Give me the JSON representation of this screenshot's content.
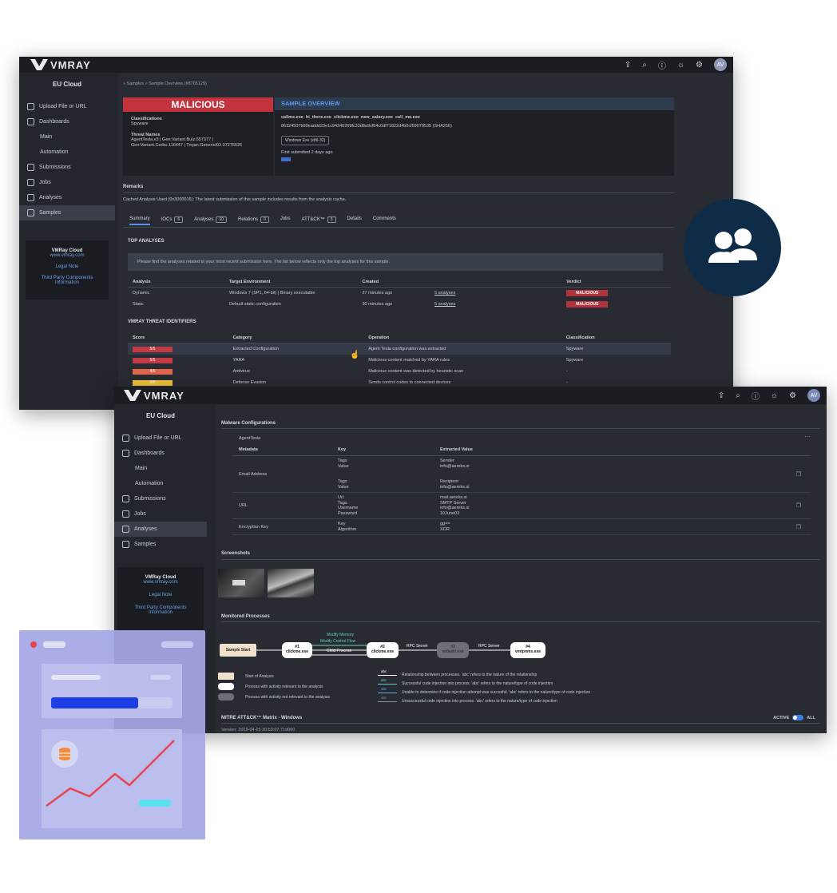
{
  "window1": {
    "logo": "VMRAY",
    "avatar": "AV",
    "region": "EU Cloud",
    "breadcrumb": "» Samples » Sample Overview (#8705129)",
    "nav": [
      {
        "label": "Upload File or URL",
        "icon": "upload-icon"
      },
      {
        "label": "Dashboards",
        "icon": "dashboard-icon"
      },
      {
        "label": "Main",
        "sub": true
      },
      {
        "label": "Automation",
        "sub": true
      },
      {
        "label": "Submissions",
        "icon": "database-icon"
      },
      {
        "label": "Jobs",
        "icon": "jobs-icon"
      },
      {
        "label": "Analyses",
        "icon": "analyses-icon"
      },
      {
        "label": "Samples",
        "icon": "file-icon",
        "active": true
      }
    ],
    "cloud": {
      "title": "VMRay Cloud",
      "url": "www.vmray.com",
      "legal": "Legal Note",
      "third_party": "Third Party Components Information"
    },
    "verdict": "MALICIOUS",
    "classifications_label": "Classifications",
    "classifications_value": "Spyware",
    "threat_names_label": "Threat Names",
    "threat_names_value": "AgentTesla.v3 | Gen:Variant.Bulz.557377 | Gen:Variant.Cerbu.116447 | Trojan.GenericKD.37276526",
    "overview_title": "SAMPLE OVERVIEW",
    "filenames": "callme.exe  hi_there.exe  clickme.exe  new_salary.exe  call_me.exe",
    "hash": "86324507b99eaddd23e1c94340269fc33d8a9cf64c6df71822d4b0cf59078535",
    "hash_type": "(SHA256)",
    "file_type": "Windows Exe (x86-32)",
    "first_submitted": "First submitted 2 days ago",
    "remarks_title": "Remarks",
    "remarks_text": "Cached Analysis Used (0x3000016): The latest submission of this sample includes results from the analysis cache.",
    "tabs": [
      {
        "label": "Summary",
        "active": true
      },
      {
        "label": "IOCs",
        "count": "6"
      },
      {
        "label": "Analyses",
        "count": "10"
      },
      {
        "label": "Relations",
        "count": "0"
      },
      {
        "label": "Jobs"
      },
      {
        "label": "ATT&CK™",
        "count": "3"
      },
      {
        "label": "Details"
      },
      {
        "label": "Comments"
      }
    ],
    "top_analyses_title": "TOP ANALYSES",
    "info_text": "Please find the analyses related to your most recent submission here. The list below reflects only the top analyses for this sample.",
    "analyses_headers": [
      "Analysis",
      "Target Environment",
      "Created",
      "",
      "Verdict"
    ],
    "analyses_rows": [
      [
        "Dynamic",
        "Windows 7 (SP1, 64-bit) | Binary executable",
        "27 minutes ago",
        "5 analyses",
        "MALICIOUS"
      ],
      [
        "Static",
        "Default static configuration",
        "30 minutes ago",
        "5 analyses",
        "MALICIOUS"
      ]
    ],
    "vti_title": "VMRAY THREAT IDENTIFIERS",
    "vti_headers": [
      "Score",
      "Category",
      "Operation",
      "Classification"
    ],
    "vti_rows": [
      {
        "score": "5/5",
        "color": "#c23a44",
        "category": "Extracted Configuration",
        "operation": "Agent Tesla configuration was extracted",
        "classification": "Spyware"
      },
      {
        "score": "5/5",
        "color": "#c23a44",
        "category": "YARA",
        "operation": "Malicious content matched by YARA rules",
        "classification": "Spyware"
      },
      {
        "score": "4/5",
        "color": "#e0654a",
        "category": "Antivirus",
        "operation": "Malicious content was detected by heuristic scan",
        "classification": "-"
      },
      {
        "score": "3/5",
        "color": "#f0c33c",
        "category": "Defense Evasion",
        "operation": "Sends control codes to connected devices",
        "classification": "-"
      }
    ]
  },
  "window2": {
    "logo": "VMRAY",
    "avatar": "AV",
    "region": "EU Cloud",
    "nav": [
      {
        "label": "Upload File or URL"
      },
      {
        "label": "Dashboards"
      },
      {
        "label": "Main",
        "sub": true
      },
      {
        "label": "Automation",
        "sub": true
      },
      {
        "label": "Submissions"
      },
      {
        "label": "Jobs"
      },
      {
        "label": "Analyses",
        "active": true
      },
      {
        "label": "Samples"
      }
    ],
    "cloud": {
      "title": "VMRay Cloud",
      "url": "www.vmray.com",
      "legal": "Legal Note",
      "third_party": "Third Party Components Information"
    },
    "malware_title": "Malware Configurations",
    "family": "AgentTesla",
    "cfg_headers": [
      "Metadata",
      "Key",
      "Extracted Value"
    ],
    "cfg_rows": [
      {
        "meta": "Email Address",
        "keys": [
          "Tags",
          "Value",
          "",
          "",
          "Tags",
          "Value"
        ],
        "values": [
          "Sender",
          "info@aereks.si",
          "",
          "",
          "Recipient",
          "info@aereks.si"
        ]
      },
      {
        "meta": "URL",
        "keys": [
          "Url",
          "Tags",
          "Username",
          "Password"
        ],
        "values": [
          "mail.aereks.si",
          "SMTP Server",
          "info@aereks.si",
          "10June03"
        ]
      },
      {
        "meta": "Encryption Key",
        "keys": [
          "Key",
          "Algorithm"
        ],
        "values": [
          "gg==",
          "XOR"
        ]
      }
    ],
    "screenshots_title": "Screenshots",
    "processes_title": "Monitored Processes",
    "proc": {
      "start": "Sample Start",
      "n1": "#1\nclickme.exe",
      "n2": "#2\nclickme.exe",
      "n3": "#3\nnetbuild.exe",
      "n4": "#4\nvmtpnms.exe",
      "e1a": "Modify Memory",
      "e1b": "Modify Control Flow",
      "e1c": "Child Process",
      "e2": "RPC Server",
      "e3": "RPC Server"
    },
    "legend_left": [
      "Start of Analysis",
      "Process with activity relevant to the analysis",
      "Process with activity not relevant to the analysis"
    ],
    "legend_right": [
      "Relationship between processes. 'abc' refers to the nature of the relationship",
      "Successful code injection into process. 'abc' refers to the nature/type of code injection",
      "Unable to determine if code injection attempt was succesful. 'abc' refers to the nature/type of code injection",
      "Unsuccessful code injection into process. 'abc' refers to the nature/type of code injection"
    ],
    "abc": "abc",
    "mitre_title": "MITRE ATT&CK™ Matrix - Windows",
    "toggle_active": "ACTIVE",
    "toggle_all": "ALL",
    "version": "Version: 2019-04-25 20:53:07.719000"
  }
}
